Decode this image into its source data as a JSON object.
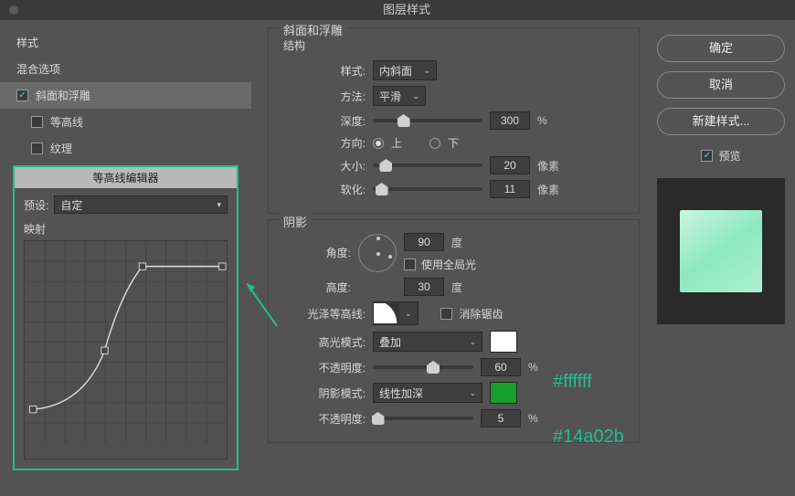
{
  "title": "图层样式",
  "sidebar": {
    "style_label": "样式",
    "blend_label": "混合选项",
    "items": [
      {
        "label": "斜面和浮雕",
        "checked": true,
        "selected": true,
        "indent": 0
      },
      {
        "label": "等高线",
        "checked": false,
        "selected": false,
        "indent": 1
      },
      {
        "label": "纹理",
        "checked": false,
        "selected": false,
        "indent": 1
      }
    ]
  },
  "contour_editor": {
    "title": "等高线编辑器",
    "preset_label": "预设:",
    "preset_value": "自定",
    "mapping_label": "映射"
  },
  "bevel": {
    "group_title": "斜面和浮雕",
    "structure_title": "结构",
    "style_label": "样式:",
    "style_value": "内斜面",
    "technique_label": "方法:",
    "technique_value": "平滑",
    "depth_label": "深度:",
    "depth_value": "300",
    "depth_unit": "%",
    "direction_label": "方向:",
    "dir_up": "上",
    "dir_down": "下",
    "size_label": "大小:",
    "size_value": "20",
    "size_unit": "像素",
    "soften_label": "软化:",
    "soften_value": "11",
    "soften_unit": "像素"
  },
  "shading": {
    "group_title": "阴影",
    "angle_label": "角度:",
    "angle_value": "90",
    "angle_unit": "度",
    "global_label": "使用全局光",
    "altitude_label": "高度:",
    "altitude_value": "30",
    "altitude_unit": "度",
    "gloss_label": "光泽等高线:",
    "antialias_label": "消除锯齿",
    "hmode_label": "高光模式:",
    "hmode_value": "叠加",
    "hopacity_label": "不透明度:",
    "hopacity_value": "60",
    "hopacity_unit": "%",
    "smode_label": "阴影模式:",
    "smode_value": "线性加深",
    "sopacity_label": "不透明度:",
    "sopacity_value": "5",
    "sopacity_unit": "%"
  },
  "colors": {
    "highlight": "#ffffff",
    "shadow": "#14a02b"
  },
  "buttons": {
    "ok": "确定",
    "cancel": "取消",
    "new_style": "新建样式...",
    "preview": "预览"
  },
  "annotations": {
    "a1": "#ffffff",
    "a2": "#14a02b"
  }
}
